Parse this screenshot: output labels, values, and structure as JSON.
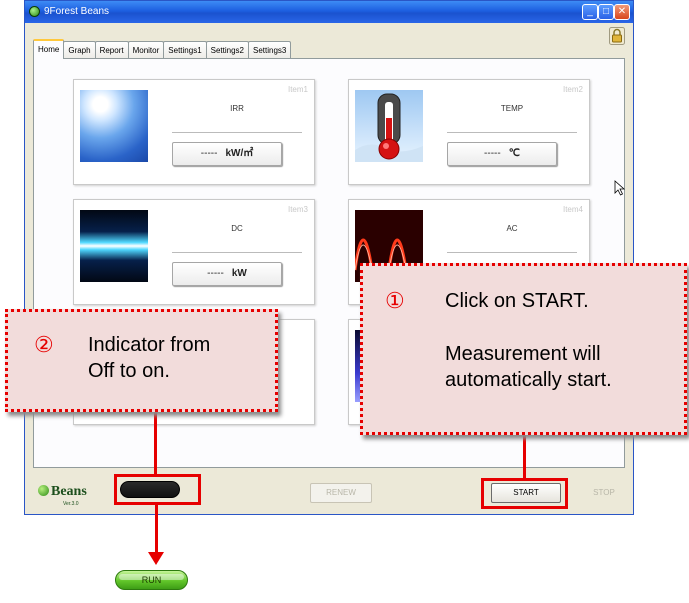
{
  "window": {
    "title": "9Forest Beans",
    "icons": [
      "app-icon",
      "minimize-icon",
      "maximize-icon",
      "close-icon",
      "lock-icon"
    ]
  },
  "tabs": [
    "Home",
    "Graph",
    "Report",
    "Monitor",
    "Settings1",
    "Settings2",
    "Settings3"
  ],
  "active_tab": "Home",
  "items": [
    {
      "id": "Item1",
      "title": "IRR",
      "value": "-----",
      "unit": "kW/㎡",
      "image": "sun-image"
    },
    {
      "id": "Item2",
      "title": "TEMP",
      "value": "-----",
      "unit": "℃",
      "image": "thermometer-image"
    },
    {
      "id": "Item3",
      "title": "DC",
      "value": "-----",
      "unit": "kW",
      "image": "dc-light-image"
    },
    {
      "id": "Item4",
      "title": "AC",
      "value": "",
      "unit": "",
      "image": "ac-wave-image"
    },
    {
      "id": "Item5",
      "image": "unknown-image"
    },
    {
      "id": "Item6",
      "image": "unknown-image"
    }
  ],
  "bottom": {
    "logo": "Beans",
    "version": "Ver.3.0",
    "renew_label": "RENEW",
    "start_label": "START",
    "stop_label": "STOP"
  },
  "callouts": {
    "c1_num": "①",
    "c1_line1": "Click on START.",
    "c1_line2": "Measurement will",
    "c1_line3": "automatically start.",
    "c2_num": "②",
    "c2_line1": "Indicator from",
    "c2_line2": "Off to on."
  },
  "run_indicator_label": "RUN",
  "colors": {
    "highlight": "#e60000",
    "callout_bg": "#f2dcdb",
    "run_green": "#62c62a"
  }
}
